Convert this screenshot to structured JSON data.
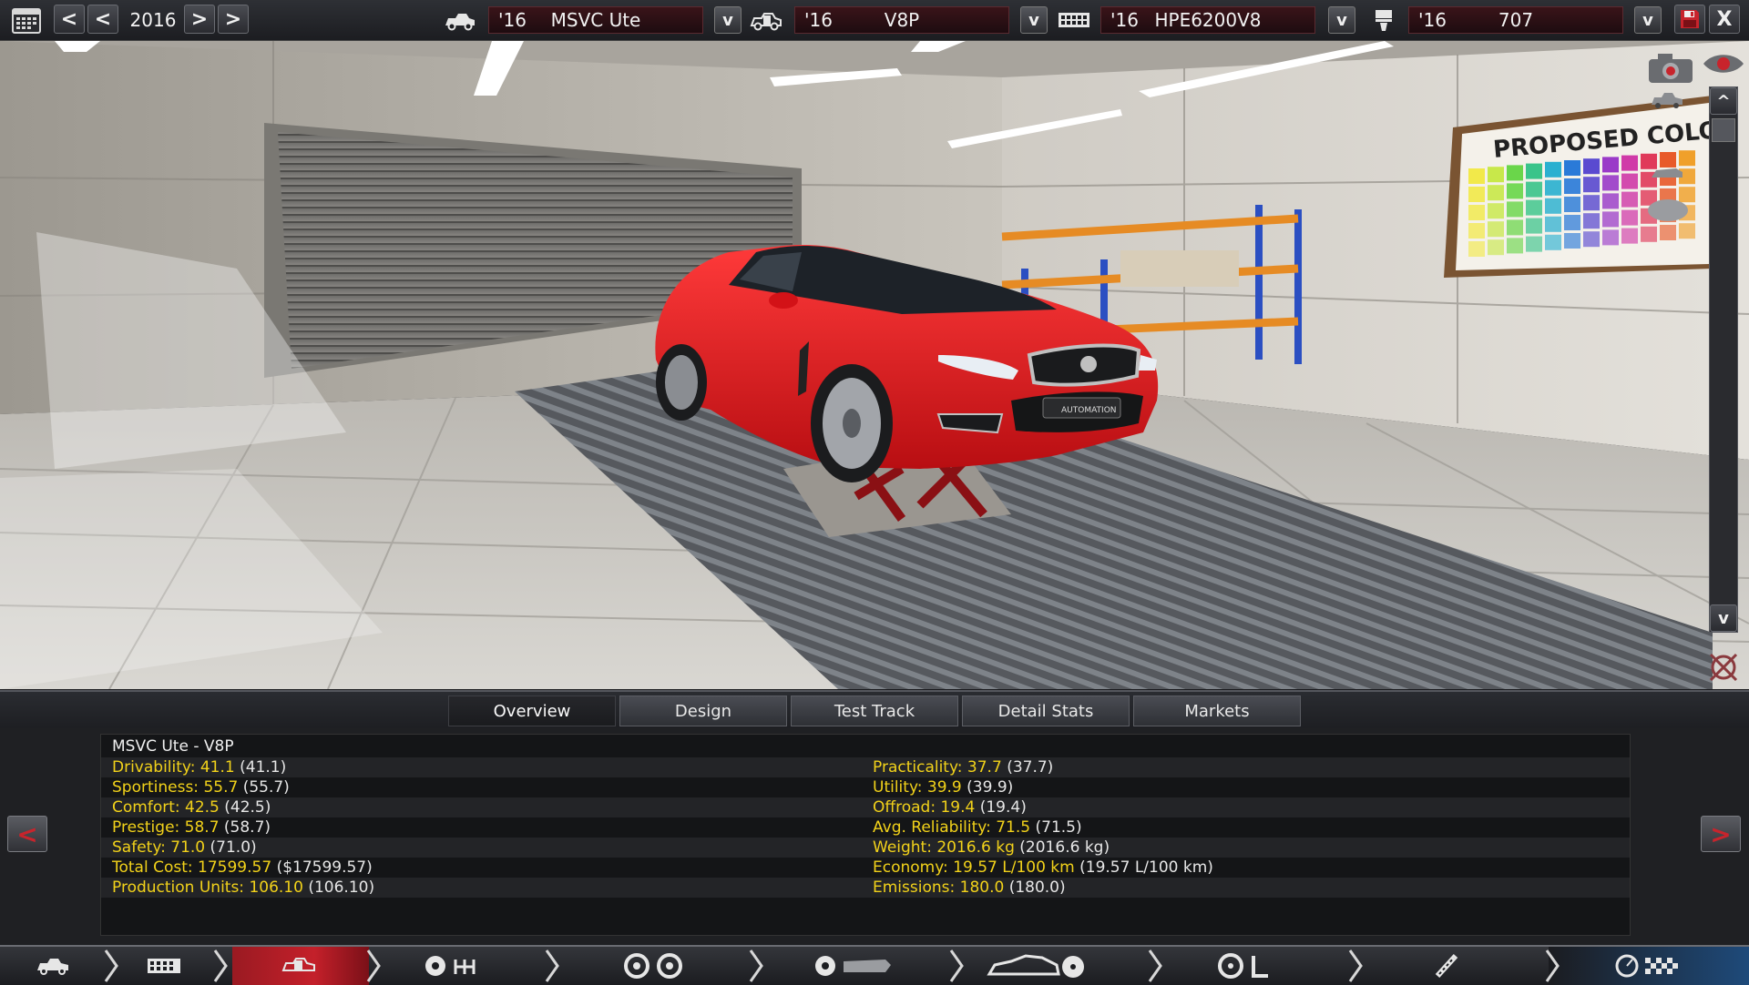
{
  "topbar": {
    "year": "2016",
    "model": {
      "year": "'16",
      "name": "MSVC Ute"
    },
    "trim": {
      "year": "'16",
      "name": "V8P"
    },
    "engine_family": {
      "year": "'16",
      "name": "HPE6200V8"
    },
    "engine_variant": {
      "year": "'16",
      "name": "707"
    },
    "dropdown_label": "v",
    "prev_label": "<",
    "next_label": ">",
    "close_label": "X"
  },
  "scene": {
    "poster_text": "PROPOSED COLO",
    "badge_text": "AUTOMATION",
    "car_color": "#e8161c"
  },
  "side_controls": {
    "up_label": "^",
    "down_label": "v"
  },
  "tabs": [
    {
      "label": "Overview",
      "active": true
    },
    {
      "label": "Design",
      "active": false
    },
    {
      "label": "Test Track",
      "active": false
    },
    {
      "label": "Detail Stats",
      "active": false
    },
    {
      "label": "Markets",
      "active": false
    }
  ],
  "overview": {
    "title": "MSVC Ute - V8P",
    "left": [
      {
        "label": "Drivability: 41.1",
        "paren": "(41.1)"
      },
      {
        "label": "Sportiness: 55.7",
        "paren": "(55.7)"
      },
      {
        "label": "Comfort: 42.5",
        "paren": "(42.5)"
      },
      {
        "label": "Prestige: 58.7",
        "paren": "(58.7)"
      },
      {
        "label": "Safety: 71.0",
        "paren": "(71.0)"
      },
      {
        "label": "Total Cost: 17599.57",
        "paren": "($17599.57)"
      },
      {
        "label": "Production Units: 106.10",
        "paren": "(106.10)"
      }
    ],
    "right": [
      {
        "label": "Practicality: 37.7",
        "paren": "(37.7)"
      },
      {
        "label": "Utility: 39.9",
        "paren": "(39.9)"
      },
      {
        "label": "Offroad: 19.4",
        "paren": "(19.4)"
      },
      {
        "label": "Avg. Reliability: 71.5",
        "paren": "(71.5)"
      },
      {
        "label": "Weight: 2016.6 kg",
        "paren": "(2016.6 kg)"
      },
      {
        "label": "Economy: 19.57 L/100 km",
        "paren": "(19.57 L/100 km)"
      },
      {
        "label": "Emissions: 180.0",
        "paren": "(180.0)"
      }
    ],
    "prev_label": "<",
    "next_label": ">"
  },
  "colors": {
    "accent": "#c4202a",
    "stat_label": "#f2d21a",
    "selector_bg": "#3a1419"
  }
}
